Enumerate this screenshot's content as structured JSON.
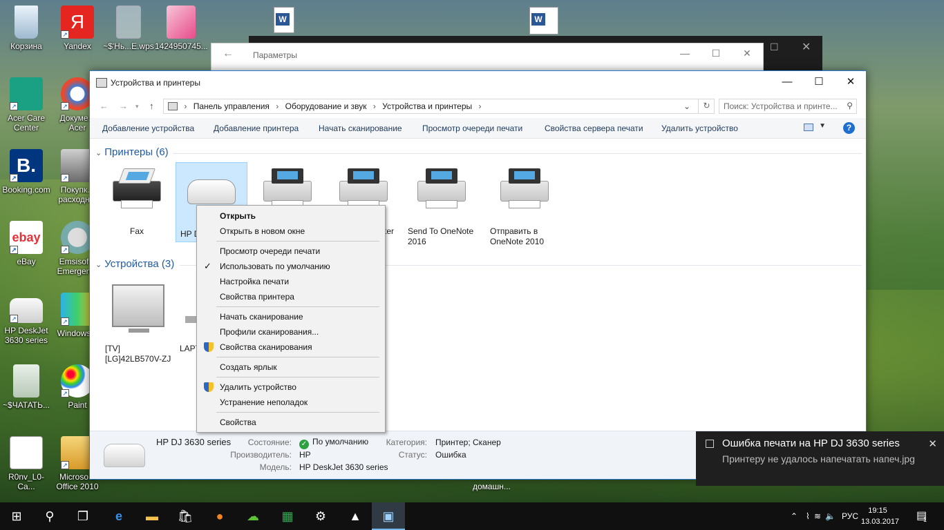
{
  "desktop": {
    "icons": [
      {
        "label": "Корзина"
      },
      {
        "label": "Yandex"
      },
      {
        "label": "~$'Нь...E.wps"
      },
      {
        "label": "1424950745..."
      },
      {
        "label": "Acer Care Center"
      },
      {
        "label": "Докуме... Acer"
      },
      {
        "label": "Booking.com"
      },
      {
        "label": "Покупк... расходн..."
      },
      {
        "label": "eBay"
      },
      {
        "label": "Emsisof... Emergen..."
      },
      {
        "label": "HP DeskJet 3630 series"
      },
      {
        "label": "Windows..."
      },
      {
        "label": "~$ЧАТАТЬ..."
      },
      {
        "label": "Paint"
      },
      {
        "label": "R0nv_L0-Ca..."
      },
      {
        "label": "Microso... Office 2010"
      }
    ],
    "bottom_text": "домашн..."
  },
  "settings_window": {
    "title": "Параметры"
  },
  "explorer": {
    "title": "Устройства и принтеры",
    "breadcrumb": [
      "Панель управления",
      "›",
      "Оборудование и звук",
      "›",
      "Устройства и принтеры",
      "›"
    ],
    "search_placeholder": "Поиск: Устройства и принте...",
    "commands": [
      "Добавление устройства",
      "Добавление принтера",
      "Начать сканирование",
      "Просмотр очереди печати",
      "Свойства сервера печати",
      "Удалить устройство"
    ],
    "printers_group": "Принтеры (6)",
    "devices_group": "Устройства (3)",
    "printers": [
      {
        "label": "Fax"
      },
      {
        "label": "HP D"
      },
      {
        "label": ""
      },
      {
        "label": "ter"
      },
      {
        "label": "Send To OneNote 2016"
      },
      {
        "label": "Отправить в OneNote 2010"
      }
    ],
    "devices": [
      {
        "label": "[TV][LG]42LB570V-ZJ"
      },
      {
        "label": "LAPT BK"
      }
    ],
    "details": {
      "name": "HP DJ 3630 series",
      "state_label": "Состояние:",
      "state_value": "По умолчанию",
      "category_label": "Категория:",
      "category_value": "Принтер; Сканер",
      "maker_label": "Производитель:",
      "maker_value": "HP",
      "status_label": "Статус:",
      "status_value": "Ошибка",
      "model_label": "Модель:",
      "model_value": "HP DeskJet 3630 series"
    }
  },
  "context_menu": {
    "items": [
      {
        "label": "Открыть"
      },
      {
        "label": "Открыть в новом окне"
      },
      {
        "label": "Просмотр очереди печати"
      },
      {
        "label": "Использовать по умолчанию"
      },
      {
        "label": "Настройка печати"
      },
      {
        "label": "Свойства принтера"
      },
      {
        "label": "Начать сканирование"
      },
      {
        "label": "Профили сканирования..."
      },
      {
        "label": "Свойства сканирования"
      },
      {
        "label": "Создать ярлык"
      },
      {
        "label": "Удалить устройство"
      },
      {
        "label": "Устранение неполадок"
      },
      {
        "label": "Свойства"
      }
    ]
  },
  "toast": {
    "title": "Ошибка печати на HP DJ 3630 series",
    "body": "Принтеру не удалось напечатать напеч.jpg"
  },
  "taskbar": {
    "lang": "РУС",
    "time": "19:15",
    "date": "13.03.2017",
    "notif_count": "1"
  }
}
